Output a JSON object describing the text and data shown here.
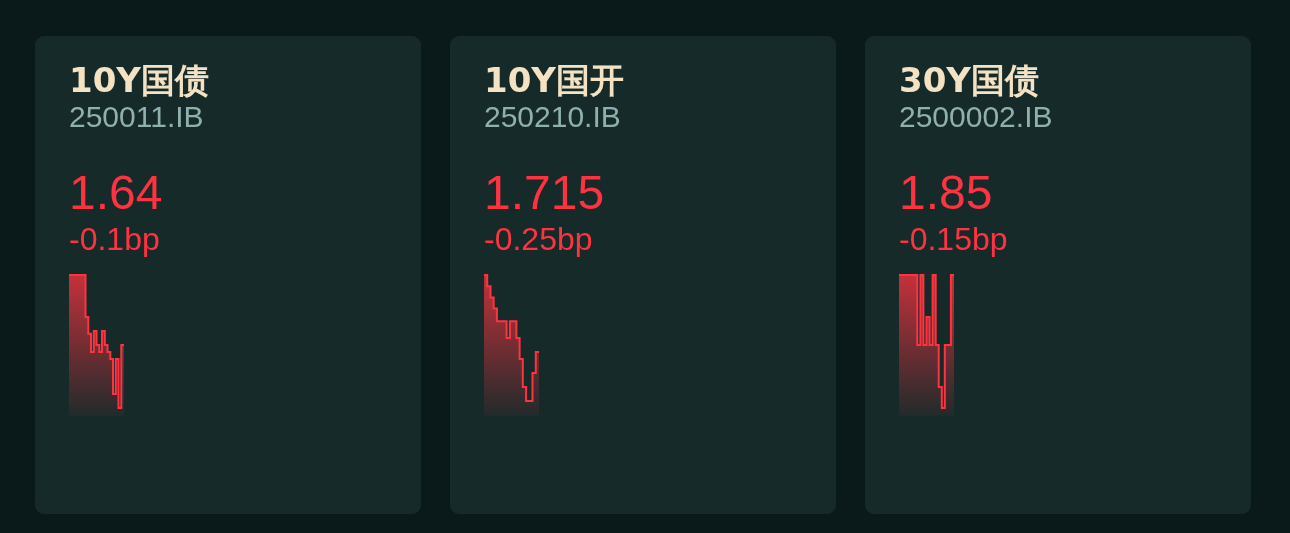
{
  "cards": [
    {
      "name": "10Y国债",
      "code": "250011.IB",
      "yield": "1.64",
      "change": "-0.1bp"
    },
    {
      "name": "10Y国开",
      "code": "250210.IB",
      "yield": "1.715",
      "change": "-0.25bp"
    },
    {
      "name": "30Y国债",
      "code": "2500002.IB",
      "yield": "1.85",
      "change": "-0.15bp"
    }
  ]
}
